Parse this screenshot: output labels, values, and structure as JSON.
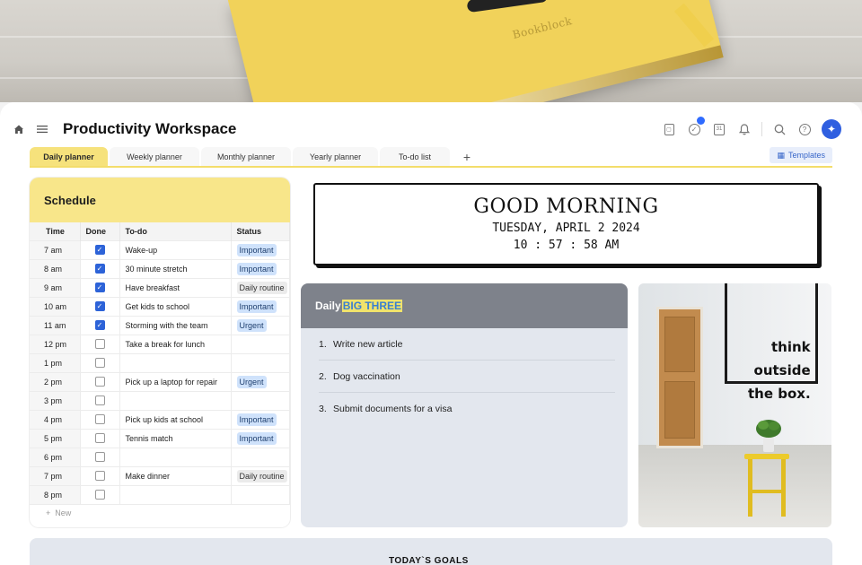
{
  "cover": {
    "brand": "Bookblock"
  },
  "header": {
    "title": "Productivity Workspace",
    "icons": [
      "home-icon",
      "menu-icon",
      "calendar-small-icon",
      "check-circle-icon",
      "calendar-icon",
      "bell-icon",
      "search-icon",
      "help-icon",
      "ai-sparkle-icon"
    ]
  },
  "tabs": [
    {
      "label": "Daily planner",
      "active": true
    },
    {
      "label": "Weekly planner",
      "active": false
    },
    {
      "label": "Monthly planner",
      "active": false
    },
    {
      "label": "Yearly planner",
      "active": false
    },
    {
      "label": "To-do list",
      "active": false
    }
  ],
  "templates_label": "Templates",
  "schedule": {
    "title": "Schedule",
    "columns": [
      "Time",
      "Done",
      "To-do",
      "Status"
    ],
    "rows": [
      {
        "time": "7 am",
        "done": true,
        "todo": "Wake-up",
        "status": "Important"
      },
      {
        "time": "8 am",
        "done": true,
        "todo": "30 minute stretch",
        "status": "Important"
      },
      {
        "time": "9 am",
        "done": true,
        "todo": "Have breakfast",
        "status": "Daily routine"
      },
      {
        "time": "10 am",
        "done": true,
        "todo": "Get kids to school",
        "status": "Important"
      },
      {
        "time": "11 am",
        "done": true,
        "todo": "Storming with the team",
        "status": "Urgent"
      },
      {
        "time": "12 pm",
        "done": false,
        "todo": "Take a break for lunch",
        "status": ""
      },
      {
        "time": "1 pm",
        "done": false,
        "todo": "",
        "status": ""
      },
      {
        "time": "2 pm",
        "done": false,
        "todo": "Pick up a laptop for repair",
        "status": "Urgent"
      },
      {
        "time": "3 pm",
        "done": false,
        "todo": "",
        "status": ""
      },
      {
        "time": "4 pm",
        "done": false,
        "todo": "Pick up kids at school",
        "status": "Important"
      },
      {
        "time": "5 pm",
        "done": false,
        "todo": "Tennis match",
        "status": "Important"
      },
      {
        "time": "6 pm",
        "done": false,
        "todo": "",
        "status": ""
      },
      {
        "time": "7 pm",
        "done": false,
        "todo": "Make dinner",
        "status": "Daily routine"
      },
      {
        "time": "8 pm",
        "done": false,
        "todo": "",
        "status": ""
      }
    ],
    "new_label": "New"
  },
  "greeting": {
    "title": "GOOD MORNING",
    "date": "TUESDAY, APRIL 2 2024",
    "time": "10 : 57 : 58 AM"
  },
  "big_three": {
    "prefix": "Daily",
    "highlight": "BIG THREE",
    "items": [
      "Write new article",
      "Dog vaccination",
      "Submit documents for a visa"
    ]
  },
  "photo": {
    "sign_lines": [
      "think",
      "outside",
      "the box."
    ]
  },
  "goals": {
    "title": "TODAY`S GOALS"
  },
  "colors": {
    "accent_yellow": "#f6e27c",
    "accent_blue": "#2f5fe0",
    "important_badge": "#cfe2fb",
    "routine_badge": "#ebebeb"
  }
}
